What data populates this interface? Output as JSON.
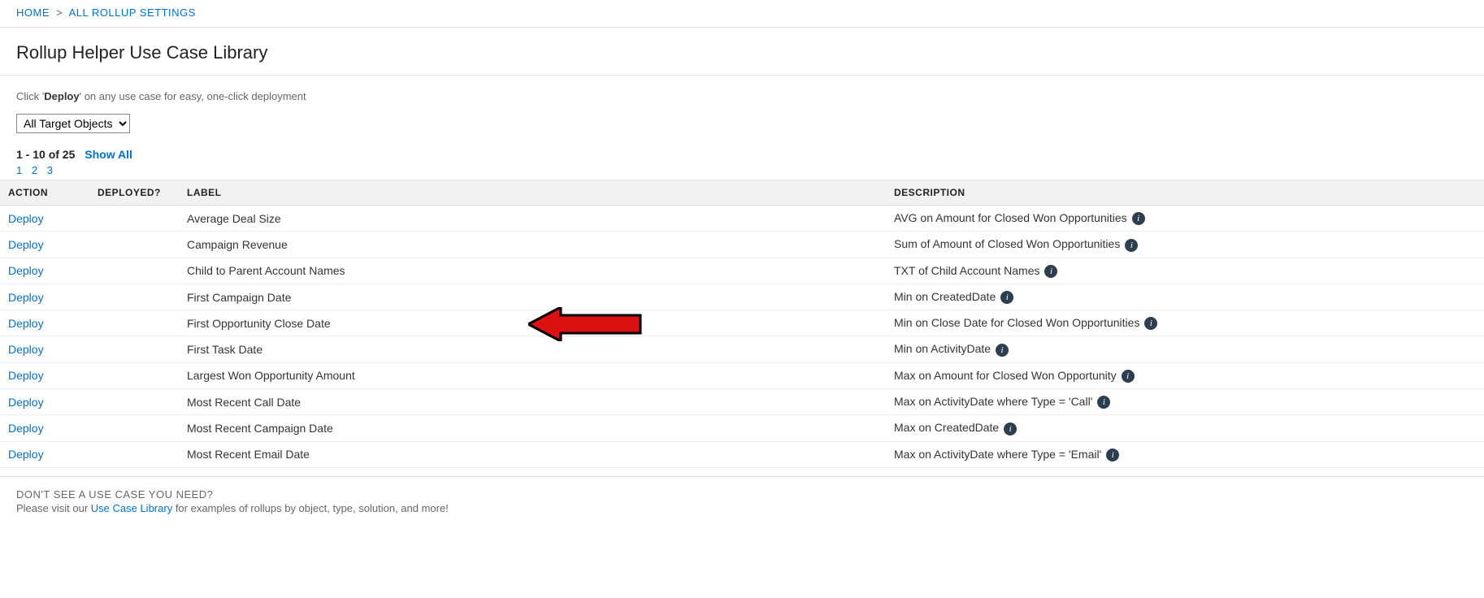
{
  "breadcrumb": {
    "home": "HOME",
    "all_settings": "ALL ROLLUP SETTINGS"
  },
  "page_title": "Rollup Helper Use Case Library",
  "instruction": {
    "prefix": "Click '",
    "bold": "Deploy",
    "suffix": "' on any use case for easy, one-click deployment"
  },
  "filter_selected": "All Target Objects",
  "pager": {
    "range": "1 - 10 of 25",
    "show_all": "Show All",
    "pages": [
      "1",
      "2",
      "3"
    ]
  },
  "columns": {
    "action": "ACTION",
    "deployed": "DEPLOYED?",
    "label": "LABEL",
    "description": "DESCRIPTION"
  },
  "deploy_label": "Deploy",
  "rows": [
    {
      "label": "Average Deal Size",
      "description": "AVG on Amount for Closed Won Opportunities",
      "info": true
    },
    {
      "label": "Campaign Revenue",
      "description": "Sum of Amount of Closed Won Opportunities",
      "info": true
    },
    {
      "label": "Child to Parent Account Names",
      "description": "TXT of Child Account Names",
      "info": true
    },
    {
      "label": "First Campaign Date",
      "description": "Min on CreatedDate",
      "info": true
    },
    {
      "label": "First Opportunity Close Date",
      "description": "Min on Close Date for Closed Won Opportunities",
      "info": true,
      "highlight_arrow": true
    },
    {
      "label": "First Task Date",
      "description": "Min on ActivityDate",
      "info": true
    },
    {
      "label": "Largest Won Opportunity Amount",
      "description": "Max on Amount for Closed Won Opportunity",
      "info": true
    },
    {
      "label": "Most Recent Call Date",
      "description": "Max on ActivityDate where Type = 'Call'",
      "info": true
    },
    {
      "label": "Most Recent Campaign Date",
      "description": "Max on CreatedDate",
      "info": true
    },
    {
      "label": "Most Recent Email Date",
      "description": "Max on ActivityDate where Type = 'Email'",
      "info": true
    }
  ],
  "footer": {
    "title": "DON'T SEE A USE CASE YOU NEED?",
    "line_prefix": "Please visit our ",
    "link": "Use Case Library",
    "line_suffix": " for examples of rollups by object, type, solution, and more!"
  }
}
